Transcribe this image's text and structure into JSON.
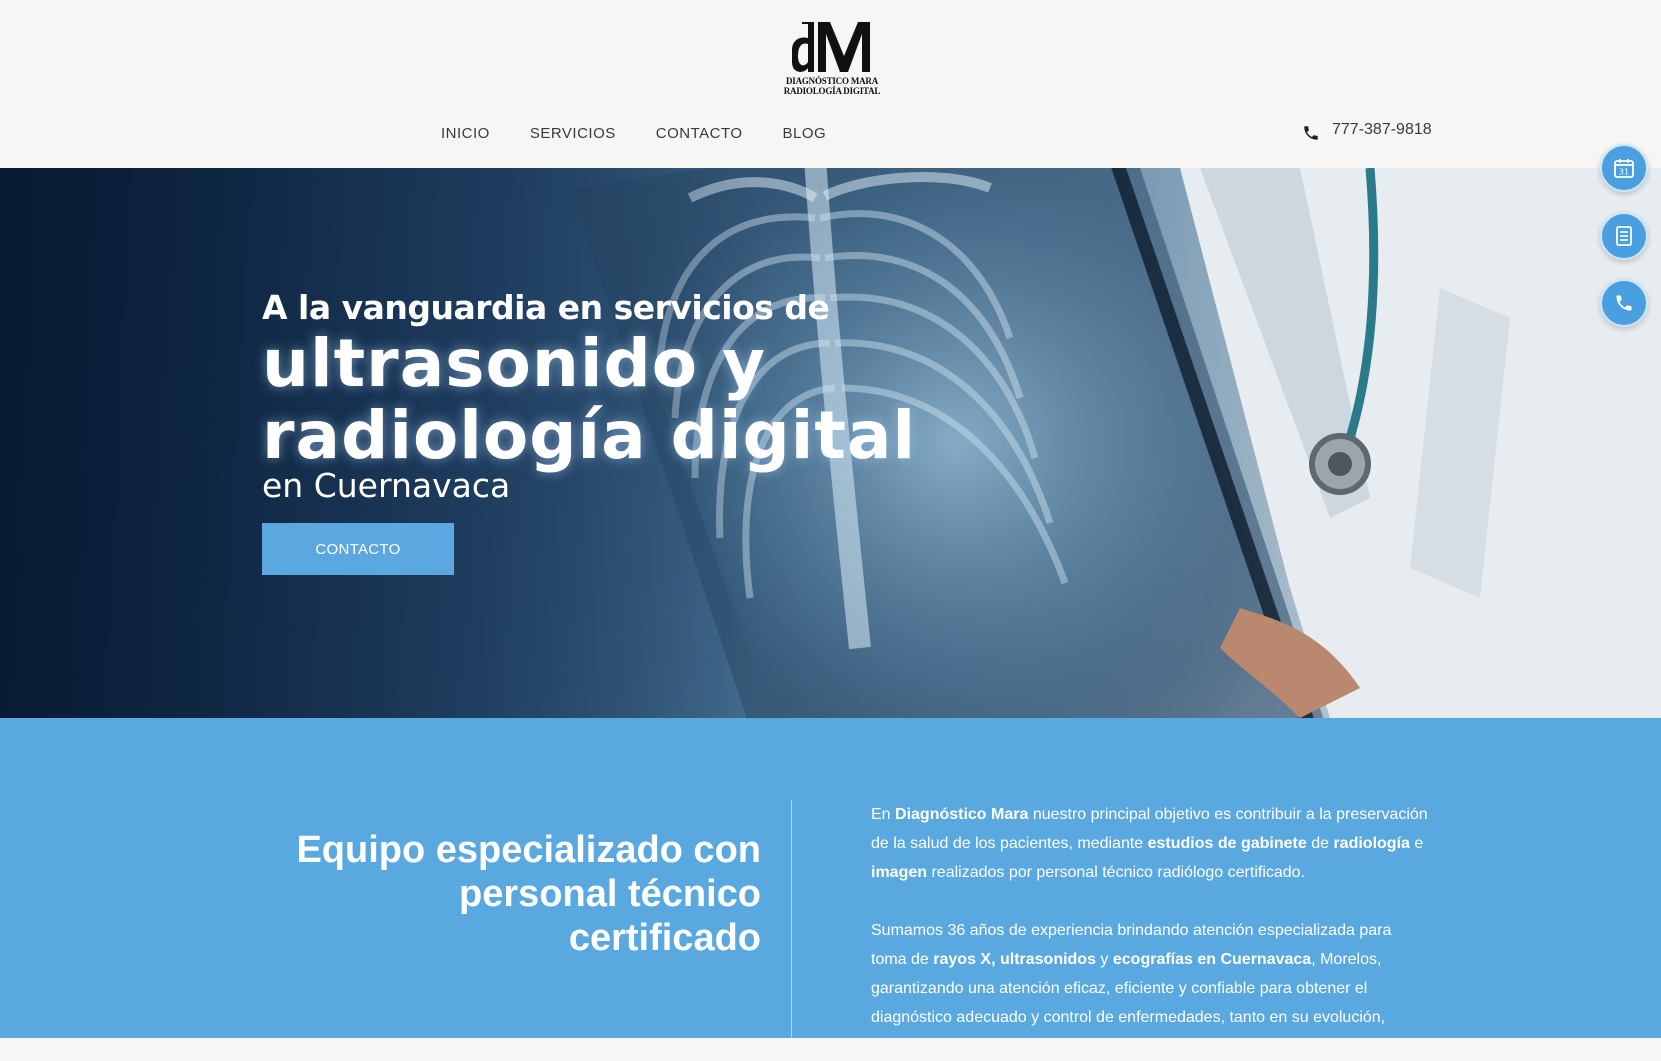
{
  "header": {
    "logo": {
      "mark": "dM",
      "line1": "DIAGNÓSTICO MARA",
      "line2": "RADIOLOGÍA DIGITAL"
    },
    "nav": [
      {
        "label": "INICIO"
      },
      {
        "label": "SERVICIOS"
      },
      {
        "label": "CONTACTO"
      },
      {
        "label": "BLOG"
      }
    ],
    "phone": {
      "icon": "phone-icon",
      "number": "777-387-9818"
    }
  },
  "hero": {
    "line1": "A la vanguardia en servicios de",
    "line2": "ultrasonido y",
    "line3": "radiología digital",
    "line4": "en Cuernavaca",
    "cta": "CONTACTO"
  },
  "floating_buttons": [
    {
      "icon": "calendar-icon",
      "day": "31"
    },
    {
      "icon": "document-icon"
    },
    {
      "icon": "phone-icon"
    }
  ],
  "about": {
    "heading": "Equipo especializado con personal técnico certificado",
    "p1": {
      "t1": " En ",
      "b1": "Diagnóstico Mara",
      "t2": " nuestro principal objetivo es contribuir a la preservación de la salud de los pacientes, mediante ",
      "b2": "estudios de gabinete",
      "t3": " de ",
      "b3": "radiología",
      "t4": " e ",
      "b4": "imagen",
      "t5": " realizados por personal técnico radiólogo certificado."
    },
    "p2": {
      "t1": "Sumamos 36 años de experiencia brindando atención especializada para toma de ",
      "b1": "rayos X, ultrasonidos",
      "t2": " y ",
      "b2": "ecografías en Cuernavaca",
      "t3": ", Morelos, garantizando una atención eficaz, eficiente y confiable para obtener el diagnóstico adecuado y control de enfermedades, tanto en su evolución,"
    }
  },
  "colors": {
    "accent": "#5ba8e0",
    "header_bg": "#f7f6f4",
    "text_dark": "#3a3a3a"
  }
}
